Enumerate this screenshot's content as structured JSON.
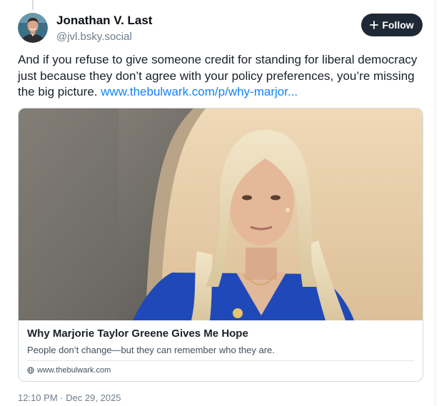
{
  "author": {
    "name": "Jonathan V. Last",
    "handle": "@jvl.bsky.social"
  },
  "follow_button": {
    "label": "Follow",
    "icon": "plus-icon"
  },
  "post": {
    "text": "And if you refuse to give someone credit for standing for liberal democracy just because they don’t agree with your policy preferences, you’re missing the big picture.",
    "link_text": "www.thebulwark.com/p/why-marjor..."
  },
  "link_card": {
    "title": "Why Marjorie Taylor Greene Gives Me Hope",
    "description": "People don’t change—but they can remember who they are.",
    "domain": "www.thebulwark.com",
    "domain_icon": "globe-icon"
  },
  "timestamp": "12:10 PM · Dec 29, 2025",
  "colors": {
    "link": "#1083fe",
    "follow_bg": "#1f2936",
    "text": "#0b0f14",
    "muted": "#6f7d8c",
    "border": "#d4dbe2"
  }
}
